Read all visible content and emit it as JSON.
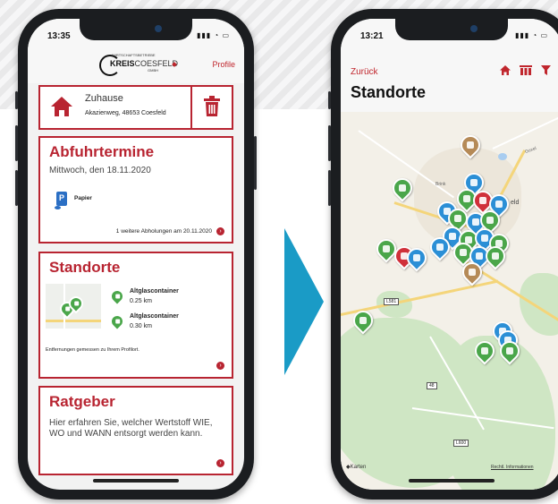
{
  "left_phone": {
    "status_time": "13:35",
    "logo": {
      "tagline": "WIRTSCHAFTSBETRIEBE",
      "brand_bold": "KREIS",
      "brand_rest": "COESFELD",
      "suffix": "GMBH"
    },
    "profile_link": "Profile",
    "home": {
      "title": "Zuhause",
      "address": "Akazienweg, 48653 Coesfeld"
    },
    "abfuhr": {
      "title": "Abfuhrtermine",
      "date": "Mittwoch, den 18.11.2020",
      "bin_letter": "P",
      "bin_label": "Papier",
      "more": "1 weitere Abholungen am 20.11.2020"
    },
    "standorte": {
      "title": "Standorte",
      "items": [
        {
          "name": "Altglascontainer",
          "distance": "0.25 km"
        },
        {
          "name": "Altglascontainer",
          "distance": "0.30 km"
        }
      ],
      "note": "Entfernungen gemessen zu Ihrem Profilort."
    },
    "ratgeber": {
      "title": "Ratgeber",
      "text": "Hier erfahren Sie, welcher Wertstoff WIE, WO und WANN entsorgt werden kann."
    }
  },
  "right_phone": {
    "status_time": "13:21",
    "back_label": "Zurück",
    "title": "Standorte",
    "map": {
      "road_labels": [
        "L581",
        "48",
        "L600"
      ],
      "place_fragments": [
        "eld",
        "Goxel",
        "Brink"
      ],
      "attribution_left": "Karten",
      "attribution_right": "Rechtl. Informationen"
    }
  },
  "colors": {
    "accent": "#b82431",
    "green_pin": "#4aa64a",
    "blue_pin": "#2b8fd6",
    "brown_pin": "#b58a57",
    "arrow": "#1a9bc6"
  }
}
